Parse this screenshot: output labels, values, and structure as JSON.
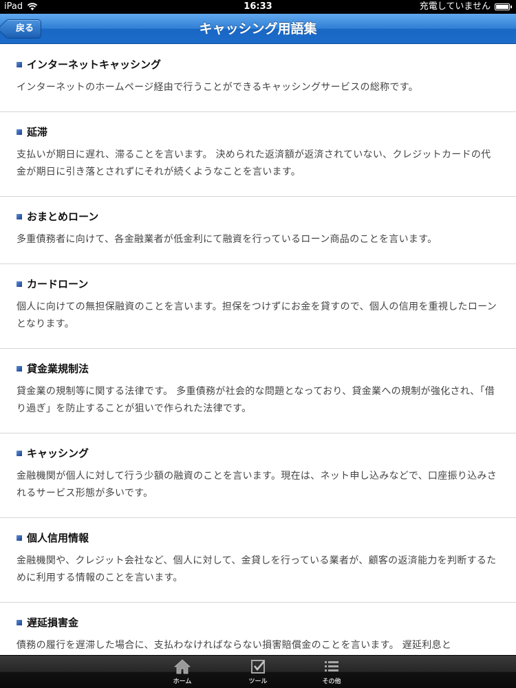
{
  "statusbar": {
    "device": "iPad",
    "time": "16:33",
    "charging": "充電していません",
    "battery_level": 0.85
  },
  "navbar": {
    "back_label": "戻る",
    "title": "キャッシング用語集"
  },
  "terms": [
    {
      "title": "インターネットキャッシング",
      "description": "インターネットのホームページ経由で行うことができるキャッシングサービスの総称です。"
    },
    {
      "title": "延滞",
      "description": "支払いが期日に遅れ、滞ることを言います。 決められた返済額が返済されていない、クレジットカードの代金が期日に引き落とされずにそれが続くようなことを言います。"
    },
    {
      "title": "おまとめローン",
      "description": "多重債務者に向けて、各金融業者が低金利にて融資を行っているローン商品のことを言います。"
    },
    {
      "title": "カードローン",
      "description": "個人に向けての無担保融資のことを言います。担保をつけずにお金を貸すので、個人の信用を重視したローンとなります。"
    },
    {
      "title": "貸金業規制法",
      "description": "貸金業の規制等に関する法律です。 多重債務が社会的な問題となっており、貸金業への規制が強化され、「借り過ぎ」を防止することが狙いで作られた法律です。"
    },
    {
      "title": "キャッシング",
      "description": "金融機関が個人に対して行う少額の融資のことを言います。現在は、ネット申し込みなどで、口座振り込みされるサービス形態が多いです。"
    },
    {
      "title": "個人信用情報",
      "description": "金融機関や、クレジット会社など、個人に対して、金貸しを行っている業者が、顧客の返済能力を判断するために利用する情報のことを言います。"
    },
    {
      "title": "遅延損害金",
      "description": "債務の履行を遅滞した場合に、支払わなければならない損害賠償金のことを言います。 遅延利息と"
    }
  ],
  "tabbar": {
    "tabs": [
      {
        "label": "ホーム",
        "icon": "home-icon"
      },
      {
        "label": "ツール",
        "icon": "checkbox-icon"
      },
      {
        "label": "その他",
        "icon": "list-icon"
      }
    ]
  }
}
